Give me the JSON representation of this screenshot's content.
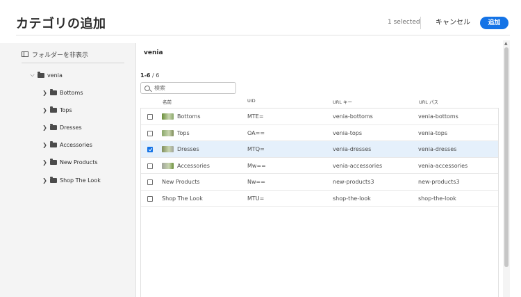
{
  "header": {
    "title": "カテゴリの追加",
    "selected": "1 selected",
    "cancel": "キャンセル",
    "add": "追加",
    "accent_color": "#1473e6"
  },
  "sidebar": {
    "toggle_label": "フォルダーを非表示",
    "root": {
      "label": "venia",
      "expanded": true
    },
    "items": [
      {
        "label": "Bottoms"
      },
      {
        "label": "Tops"
      },
      {
        "label": "Dresses"
      },
      {
        "label": "Accessories"
      },
      {
        "label": "New Products"
      },
      {
        "label": "Shop The Look"
      }
    ]
  },
  "main": {
    "folder_name": "venia",
    "count_range": "1-6",
    "count_total": " / 6",
    "search_placeholder": "検索",
    "columns": [
      "名前",
      "UID",
      "URL キー",
      "URL パス"
    ],
    "rows": [
      {
        "name": "Bottoms",
        "uid": "MTE=",
        "url_key": "venia-bottoms",
        "url_path": "venia-bottoms",
        "checked": false,
        "thumb": true
      },
      {
        "name": "Tops",
        "uid": "OA==",
        "url_key": "venia-tops",
        "url_path": "venia-tops",
        "checked": false,
        "thumb": true
      },
      {
        "name": "Dresses",
        "uid": "MTQ=",
        "url_key": "venia-dresses",
        "url_path": "venia-dresses",
        "checked": true,
        "thumb": true
      },
      {
        "name": "Accessories",
        "uid": "Mw==",
        "url_key": "venia-accessories",
        "url_path": "venia-accessories",
        "checked": false,
        "thumb": true
      },
      {
        "name": "New Products",
        "uid": "Nw==",
        "url_key": "new-products3",
        "url_path": "new-products3",
        "checked": false,
        "thumb": false
      },
      {
        "name": "Shop The Look",
        "uid": "MTU=",
        "url_key": "shop-the-look",
        "url_path": "shop-the-look",
        "checked": false,
        "thumb": false
      }
    ]
  }
}
